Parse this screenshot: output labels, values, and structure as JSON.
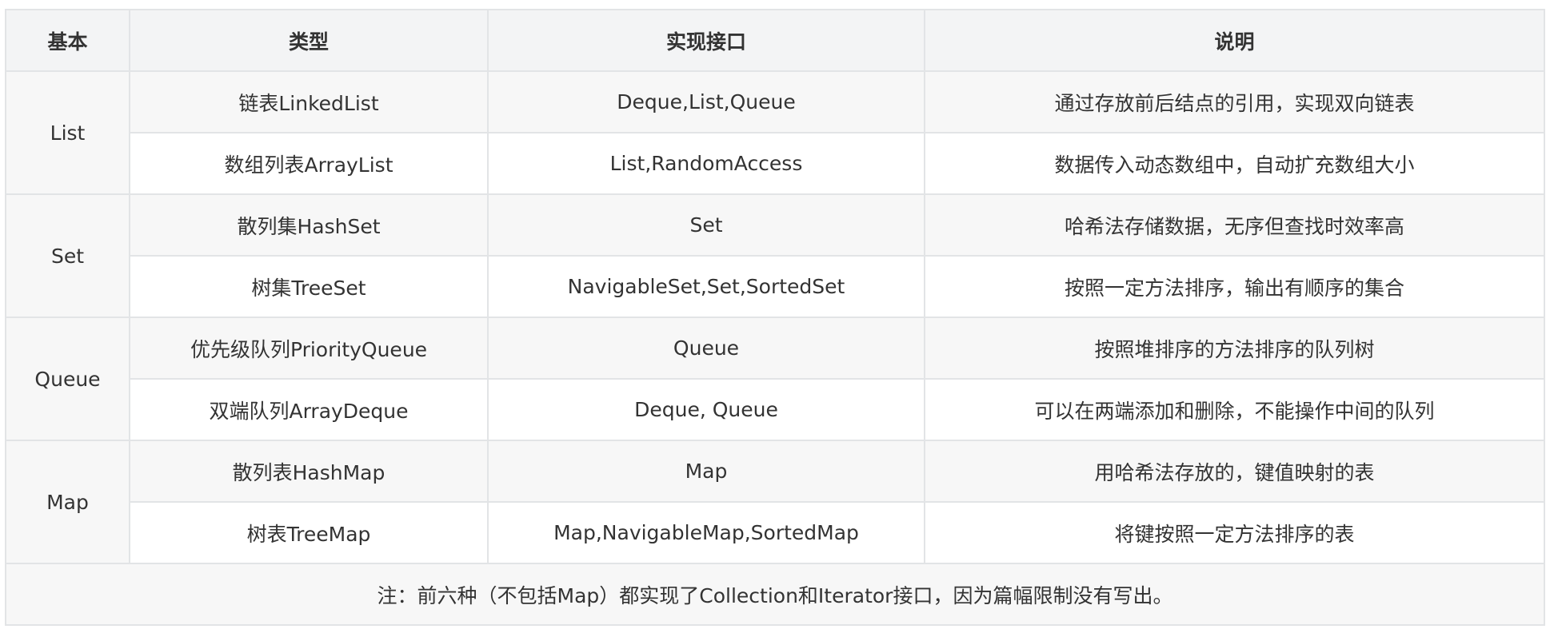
{
  "table": {
    "headers": [
      "基本",
      "类型",
      "实现接口",
      "说明"
    ],
    "groups": [
      {
        "name": "List",
        "rows": [
          {
            "type": "链表LinkedList",
            "interfaces": "Deque,List,Queue",
            "desc": "通过存放前后结点的引用，实现双向链表"
          },
          {
            "type": "数组列表ArrayList",
            "interfaces": "List,RandomAccess",
            "desc": "数据传入动态数组中，自动扩充数组大小"
          }
        ]
      },
      {
        "name": "Set",
        "rows": [
          {
            "type": "散列集HashSet",
            "interfaces": "Set",
            "desc": "哈希法存储数据，无序但查找时效率高"
          },
          {
            "type": "树集TreeSet",
            "interfaces": "NavigableSet,Set,SortedSet",
            "desc": "按照一定方法排序，输出有顺序的集合"
          }
        ]
      },
      {
        "name": "Queue",
        "rows": [
          {
            "type": "优先级队列PriorityQueue",
            "interfaces": "Queue",
            "desc": "按照堆排序的方法排序的队列树"
          },
          {
            "type": "双端队列ArrayDeque",
            "interfaces": "Deque, Queue",
            "desc": "可以在两端添加和删除，不能操作中间的队列"
          }
        ]
      },
      {
        "name": "Map",
        "rows": [
          {
            "type": "散列表HashMap",
            "interfaces": "Map",
            "desc": "用哈希法存放的，键值映射的表"
          },
          {
            "type": "树表TreeMap",
            "interfaces": "Map,NavigableMap,SortedMap",
            "desc": "将键按照一定方法排序的表"
          }
        ]
      }
    ],
    "note": "注：前六种（不包括Map）都实现了Collection和Iterator接口，因为篇幅限制没有写出。"
  }
}
